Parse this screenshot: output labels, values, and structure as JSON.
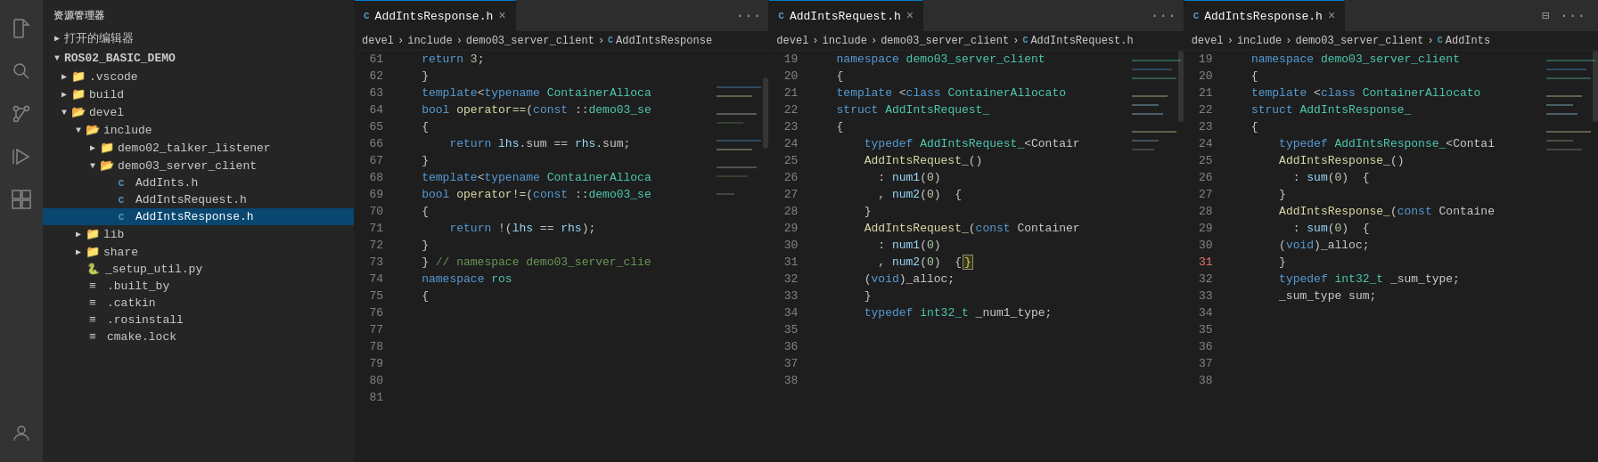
{
  "activityBar": {
    "icons": [
      {
        "name": "files-icon",
        "symbol": "⬜",
        "active": false,
        "label": "Explorer"
      },
      {
        "name": "search-icon",
        "symbol": "🔍",
        "active": false,
        "label": "Search"
      },
      {
        "name": "source-control-icon",
        "symbol": "⑂",
        "active": false,
        "label": "Source Control"
      },
      {
        "name": "run-icon",
        "symbol": "▶",
        "active": false,
        "label": "Run"
      },
      {
        "name": "extensions-icon",
        "symbol": "⊞",
        "active": false,
        "label": "Extensions"
      }
    ]
  },
  "sidebar": {
    "title": "资源管理器",
    "openEditors": "打开的编辑器",
    "root": "ROS02_BASIC_DEMO",
    "tree": [
      {
        "label": ".vscode",
        "type": "folder",
        "indent": 1,
        "collapsed": true
      },
      {
        "label": "build",
        "type": "folder",
        "indent": 1,
        "collapsed": true
      },
      {
        "label": "devel",
        "type": "folder",
        "indent": 1,
        "collapsed": false
      },
      {
        "label": "include",
        "type": "folder",
        "indent": 2,
        "collapsed": false
      },
      {
        "label": "demo02_talker_listener",
        "type": "folder",
        "indent": 3,
        "collapsed": true
      },
      {
        "label": "demo03_server_client",
        "type": "folder",
        "indent": 3,
        "collapsed": false
      },
      {
        "label": "AddInts.h",
        "type": "file-c",
        "indent": 4
      },
      {
        "label": "AddIntsRequest.h",
        "type": "file-c",
        "indent": 4
      },
      {
        "label": "AddIntsResponse.h",
        "type": "file-c",
        "indent": 4,
        "selected": true
      },
      {
        "label": "lib",
        "type": "folder",
        "indent": 2,
        "collapsed": true
      },
      {
        "label": "share",
        "type": "folder",
        "indent": 2,
        "collapsed": true
      },
      {
        "label": "_setup_util.py",
        "type": "file-py",
        "indent": 2
      },
      {
        "label": ".built_by",
        "type": "file-config",
        "indent": 2
      },
      {
        "label": ".catkin",
        "type": "file-config",
        "indent": 2
      },
      {
        "label": ".rosinstall",
        "type": "file-config",
        "indent": 2
      },
      {
        "label": "cmake.lock",
        "type": "file-config",
        "indent": 2
      }
    ]
  },
  "editors": [
    {
      "id": "editor1",
      "tab": {
        "title": "AddIntsResponse.h",
        "active": true,
        "icon": "C"
      },
      "breadcrumb": "devel > include > demo03_server_client > C AddIntsResponse",
      "lines": [
        {
          "num": 61,
          "code": "    <span class='kw'>return</span> <span class='num'>3</span>;"
        },
        {
          "num": 62,
          "code": "    }"
        },
        {
          "num": 63,
          "code": ""
        },
        {
          "num": 64,
          "code": ""
        },
        {
          "num": 65,
          "code": "    <span class='kw'>template</span>&lt;<span class='kw'>typename</span> ContainerAlloca"
        },
        {
          "num": 66,
          "code": "    <span class='kw'>bool</span> <span class='fn'>operator==</span>(<span class='kw'>const</span> ::<span class='ns'>demo03_se</span>"
        },
        {
          "num": 67,
          "code": "    {"
        },
        {
          "num": 68,
          "code": "        <span class='kw'>return</span> lhs.sum == rhs.sum;"
        },
        {
          "num": 69,
          "code": "    }"
        },
        {
          "num": 70,
          "code": ""
        },
        {
          "num": 71,
          "code": "    <span class='kw'>template</span>&lt;<span class='kw'>typename</span> ContainerAlloca"
        },
        {
          "num": 72,
          "code": "    <span class='kw'>bool</span> <span class='fn'>operator!=</span>(<span class='kw'>const</span> ::<span class='ns'>demo03_se</span>"
        },
        {
          "num": 73,
          "code": "    {"
        },
        {
          "num": 74,
          "code": "        <span class='kw'>return</span> !(<span class='var'>lhs</span> == <span class='var'>rhs</span>);"
        },
        {
          "num": 75,
          "code": "    }"
        },
        {
          "num": 76,
          "code": ""
        },
        {
          "num": 77,
          "code": ""
        },
        {
          "num": 78,
          "code": "    } <span class='comment'>// namespace demo03_server_clie</span>"
        },
        {
          "num": 79,
          "code": ""
        },
        {
          "num": 80,
          "code": "    <span class='kw'>namespace</span> <span class='ns'>ros</span>"
        },
        {
          "num": 81,
          "code": "    {"
        }
      ]
    },
    {
      "id": "editor2",
      "tab": {
        "title": "AddIntsRequest.h",
        "active": false,
        "icon": "C"
      },
      "breadcrumb": "devel > include > demo03_server_client > C AddIntsRequest.h",
      "lines": [
        {
          "num": 19,
          "code": "    <span class='kw'>namespace</span> <span class='ns'>demo03_server_client</span>"
        },
        {
          "num": 20,
          "code": "    {"
        },
        {
          "num": 21,
          "code": "    <span class='kw'>template</span> &lt;<span class='kw'>class</span> <span class='type'>ContainerAllocato</span>"
        },
        {
          "num": 22,
          "code": "    <span class='kw'>struct</span> <span class='type'>AddIntsRequest_</span>"
        },
        {
          "num": 23,
          "code": "    {"
        },
        {
          "num": 24,
          "code": "        <span class='kw'>typedef</span> <span class='type'>AddIntsRequest_</span>&lt;Contair"
        },
        {
          "num": 25,
          "code": ""
        },
        {
          "num": 26,
          "code": "        <span class='fn'>AddIntsRequest_</span>()"
        },
        {
          "num": 27,
          "code": "          : <span class='var'>num1</span>(<span class='num'>0</span>)"
        },
        {
          "num": 28,
          "code": "          , <span class='var'>num2</span>(<span class='num'>0</span>)  {"
        },
        {
          "num": 29,
          "code": "        }"
        },
        {
          "num": 30,
          "code": "        <span class='fn'>AddIntsRequest_</span>(<span class='kw'>const</span> Container"
        },
        {
          "num": 31,
          "code": "          : <span class='var'>num1</span>(<span class='num'>0</span>)"
        },
        {
          "num": 32,
          "code": "          , <span class='var'>num2</span>(<span class='num'>0</span>)  {"
        },
        {
          "num": 33,
          "code": "        (<span class='kw'>void</span>)_alloc;"
        },
        {
          "num": 34,
          "code": "        }"
        },
        {
          "num": 35,
          "code": ""
        },
        {
          "num": 36,
          "code": ""
        },
        {
          "num": 37,
          "code": ""
        },
        {
          "num": 38,
          "code": "        <span class='kw'>typedef</span> <span class='type'>int32_t</span> _num1_type;"
        }
      ]
    },
    {
      "id": "editor3",
      "tab": {
        "title": "AddIntsResponse.h",
        "active": false,
        "icon": "C"
      },
      "breadcrumb": "devel > include > demo03_server_client > C AddInts",
      "lines": [
        {
          "num": 19,
          "code": "    <span class='kw'>namespace</span> <span class='ns'>demo03_server_client</span>"
        },
        {
          "num": 20,
          "code": "    {"
        },
        {
          "num": 21,
          "code": "    <span class='kw'>template</span> &lt;<span class='kw'>class</span> <span class='type'>ContainerAllocato</span>"
        },
        {
          "num": 22,
          "code": "    <span class='kw'>struct</span> <span class='type'>AddIntsResponse_</span>"
        },
        {
          "num": 23,
          "code": "    {"
        },
        {
          "num": 24,
          "code": "        <span class='kw'>typedef</span> <span class='type'>AddIntsResponse_</span>&lt;Contai"
        },
        {
          "num": 25,
          "code": ""
        },
        {
          "num": 26,
          "code": "        <span class='fn'>AddIntsResponse_</span>()"
        },
        {
          "num": 27,
          "code": "          : <span class='var'>sum</span>(<span class='num'>0</span>)  {"
        },
        {
          "num": 28,
          "code": "        }"
        },
        {
          "num": 29,
          "code": "        <span class='fn'>AddIntsResponse_</span>(<span class='kw'>const</span> Containe"
        },
        {
          "num": 30,
          "code": "          : <span class='var'>sum</span>(<span class='num'>0</span>)  {"
        },
        {
          "num": 31,
          "code": "        (<span class='kw'>void</span>)_alloc;"
        },
        {
          "num": 32,
          "code": "        }"
        },
        {
          "num": 33,
          "code": ""
        },
        {
          "num": 34,
          "code": ""
        },
        {
          "num": 35,
          "code": ""
        },
        {
          "num": 36,
          "code": "        <span class='kw'>typedef</span> <span class='type'>int32_t</span> _sum_type;"
        },
        {
          "num": 37,
          "code": "        _sum_type sum;"
        },
        {
          "num": 38,
          "code": ""
        }
      ]
    }
  ]
}
